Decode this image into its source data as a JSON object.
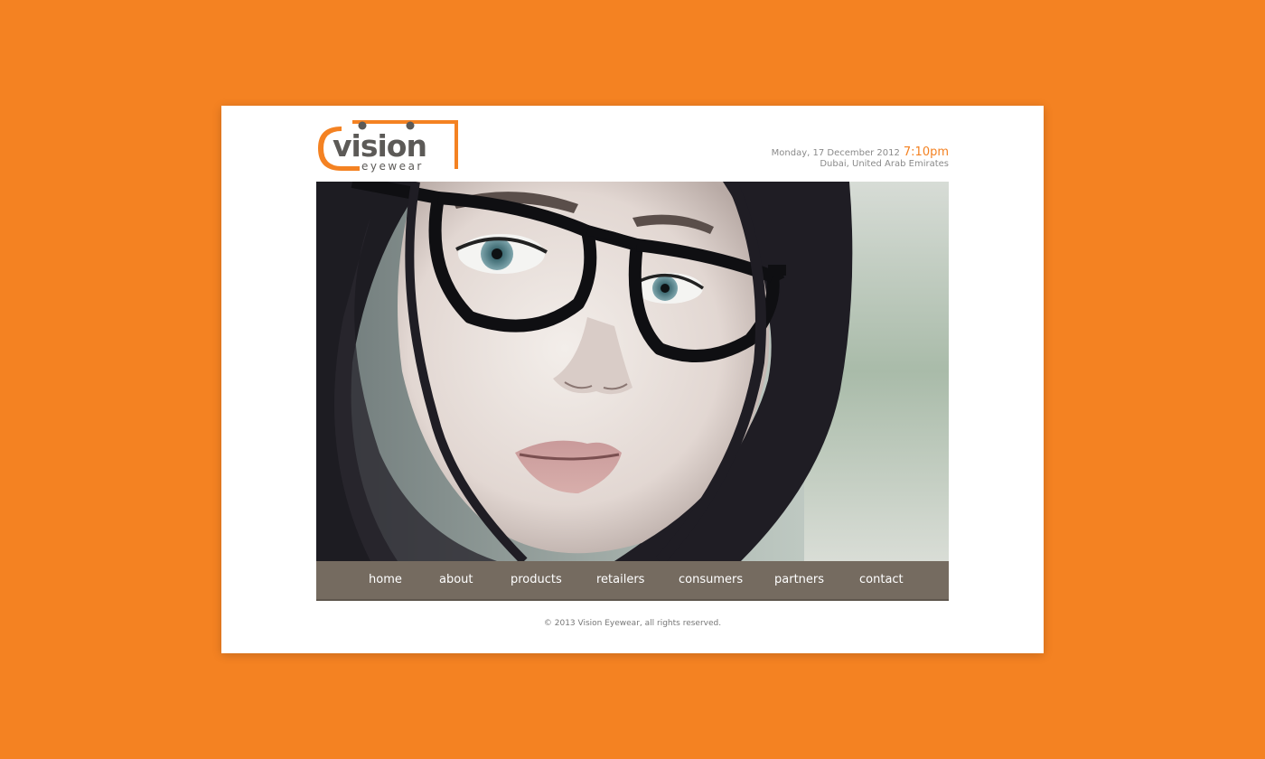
{
  "brand": {
    "name": "vision",
    "tagline": "eyewear",
    "accent_color": "#f48222",
    "text_color": "#5c5a57"
  },
  "header": {
    "date": "Monday, 17 December 2012",
    "time": "7:10pm",
    "location": "Dubai, United Arab Emirates"
  },
  "hero": {
    "image": "portrait-woman-black-glasses"
  },
  "nav": {
    "items": [
      {
        "label": "home"
      },
      {
        "label": "about"
      },
      {
        "label": "products"
      },
      {
        "label": "retailers"
      },
      {
        "label": "consumers"
      },
      {
        "label": "partners"
      },
      {
        "label": "contact"
      }
    ],
    "background_color": "#756b60"
  },
  "footer": {
    "text": "© 2013 Vision Eyewear, all rights reserved."
  }
}
